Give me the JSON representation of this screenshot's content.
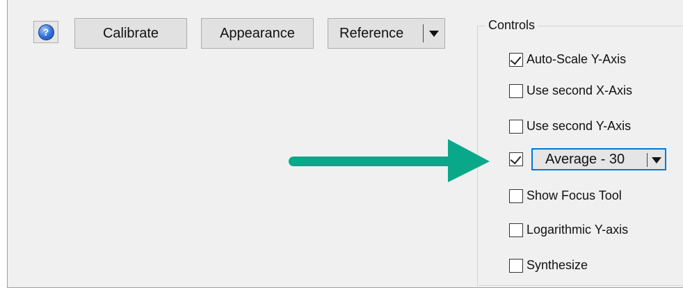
{
  "toolbar": {
    "help_glyph": "?",
    "calibrate_label": "Calibrate",
    "appearance_label": "Appearance",
    "reference_label": "Reference"
  },
  "controls": {
    "title": "Controls",
    "items": [
      {
        "label": "Auto-Scale Y-Axis",
        "checked": true
      },
      {
        "label": "Use second X-Axis",
        "checked": false
      },
      {
        "label": "Use second Y-Axis",
        "checked": false
      },
      {
        "label": "",
        "checked": true
      },
      {
        "label": "Show Focus Tool",
        "checked": false
      },
      {
        "label": "Logarithmic Y-axis",
        "checked": false
      },
      {
        "label": "Synthesize",
        "checked": false
      }
    ],
    "average_select": {
      "value": "Average - 30"
    }
  },
  "colors": {
    "arrow": "#0aa88a",
    "focus_border": "#0078d7",
    "panel_bg": "#f0f0f0"
  }
}
